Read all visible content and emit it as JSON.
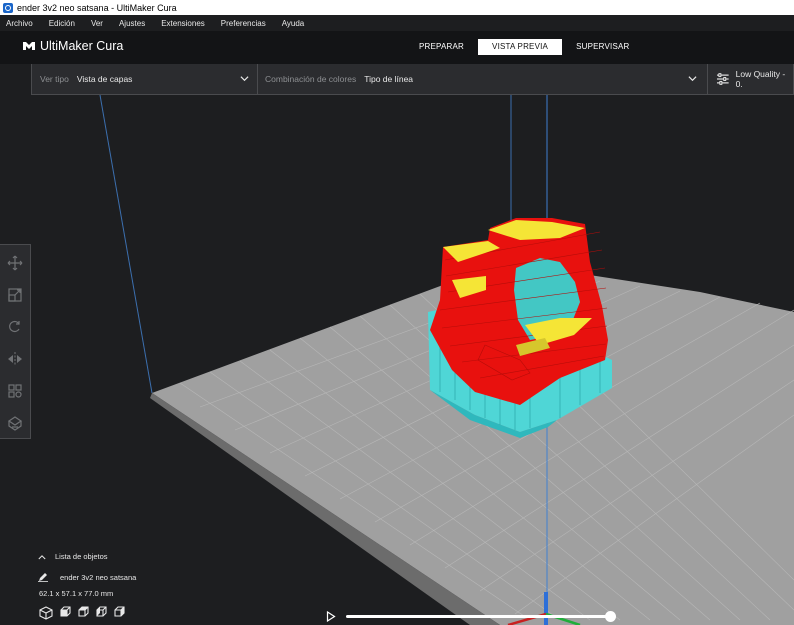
{
  "window": {
    "title": "ender 3v2 neo satsana - UltiMaker Cura"
  },
  "menu": [
    "Archivo",
    "Edición",
    "Ver",
    "Ajustes",
    "Extensiones",
    "Preferencias",
    "Ayuda"
  ],
  "header": {
    "logo_text": "UltiMaker Cura",
    "stages": [
      {
        "label": "PREPARAR",
        "active": false
      },
      {
        "label": "VISTA PREVIA",
        "active": true
      },
      {
        "label": "SUPERVISAR",
        "active": false
      }
    ]
  },
  "toolbar": {
    "view_type_label": "Ver tipo",
    "view_type_value": "Vista de capas",
    "color_scheme_label": "Combinación de colores",
    "color_scheme_value": "Tipo de línea",
    "quality_text": "Low Quality - 0."
  },
  "tools": [
    "move-icon",
    "scale-icon",
    "rotate-icon",
    "mirror-icon",
    "per-model-settings-icon",
    "support-blocker-icon"
  ],
  "object_list": {
    "header": "Lista de objetos",
    "items": [
      {
        "name": "ender 3v2 neo satsana"
      }
    ],
    "dimensions": "62.1 x 57.1 x 77.0 mm"
  },
  "layer_slider": {
    "progress": 1.0
  },
  "colors": {
    "background": "#1d1e20",
    "plate": "#9c9c9c",
    "wall": "#e8110e",
    "support": "#4fd6d6",
    "skin": "#f5e536",
    "axis_blue": "#2d6fd8"
  }
}
